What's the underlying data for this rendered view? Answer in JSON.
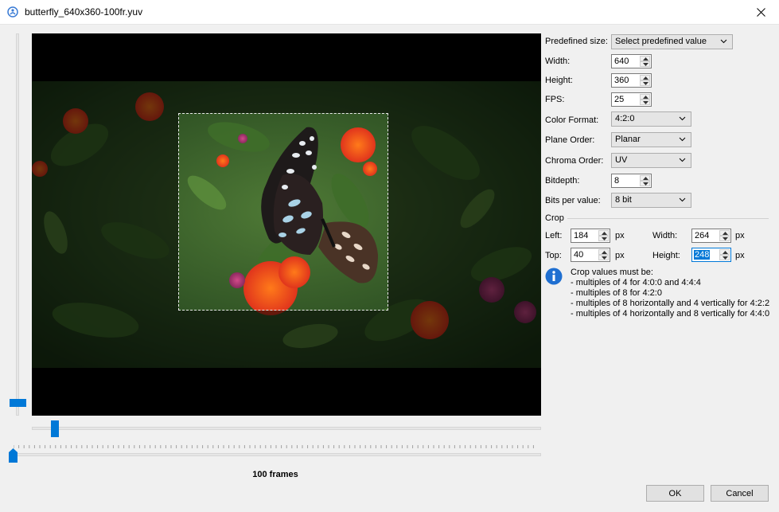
{
  "window": {
    "title": "butterfly_640x360-100fr.yuv"
  },
  "preview": {
    "frames_label": "100 frames"
  },
  "form": {
    "predefined_size": {
      "label": "Predefined size:",
      "value": "Select predefined value"
    },
    "width": {
      "label": "Width:",
      "value": "640"
    },
    "height": {
      "label": "Height:",
      "value": "360"
    },
    "fps": {
      "label": "FPS:",
      "value": "25"
    },
    "color_format": {
      "label": "Color Format:",
      "value": "4:2:0"
    },
    "plane_order": {
      "label": "Plane Order:",
      "value": "Planar"
    },
    "chroma_order": {
      "label": "Chroma Order:",
      "value": "UV"
    },
    "bitdepth": {
      "label": "Bitdepth:",
      "value": "8"
    },
    "bits_per_value": {
      "label": "Bits per value:",
      "value": "8 bit"
    }
  },
  "crop": {
    "section_label": "Crop",
    "left": {
      "label": "Left:",
      "value": "184",
      "unit": "px"
    },
    "width": {
      "label": "Width:",
      "value": "264",
      "unit": "px"
    },
    "top": {
      "label": "Top:",
      "value": "40",
      "unit": "px"
    },
    "height": {
      "label": "Height:",
      "value": "248",
      "unit": "px"
    },
    "info": {
      "heading": "Crop values must be:",
      "lines": [
        "- multiples of 4 for 4:0:0 and 4:4:4",
        "- multiples of 8 for 4:2:0",
        "- multiples of 8 horizontally and 4 vertically for 4:2:2",
        "- multiples of 4 horizontally and 8 vertically for 4:4:0"
      ]
    }
  },
  "buttons": {
    "ok": "OK",
    "cancel": "Cancel"
  },
  "colors": {
    "accent": "#0078d7",
    "background": "#f0f0f0"
  }
}
